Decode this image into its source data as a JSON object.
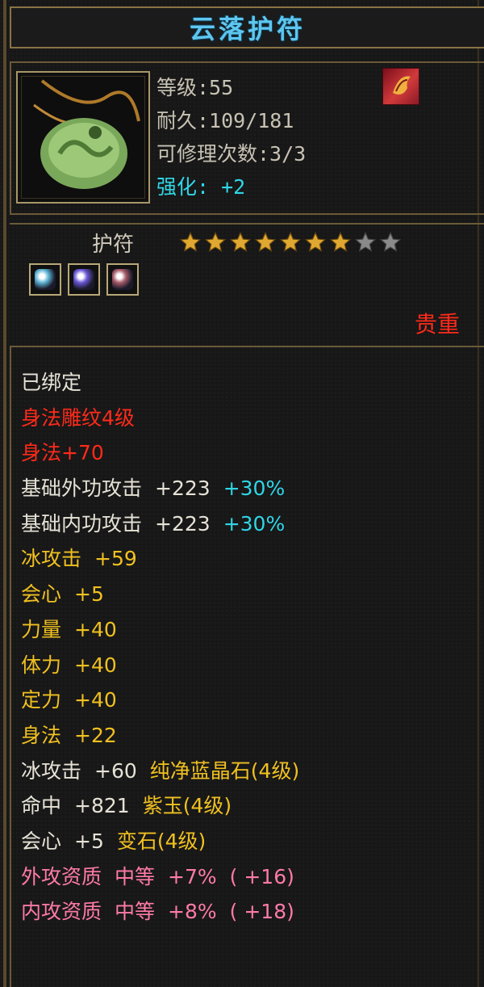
{
  "title": "云落护符",
  "info": {
    "level": "等级:55",
    "durability": "耐久:109/181",
    "repairs": "可修理次数:3/3",
    "enhance": "强化: +2"
  },
  "icons": {
    "item": "jade-pendant-icon",
    "bag": "bind-bag-icon"
  },
  "type": {
    "label": "护符",
    "stars_filled": 7,
    "stars_total": 9,
    "gems": [
      {
        "name": "ice-gem-icon",
        "color": "#5fb6d6"
      },
      {
        "name": "purple-gem-icon",
        "color": "#6a58d8"
      },
      {
        "name": "red-gem-icon",
        "color": "#a85a68"
      }
    ]
  },
  "rarity": "贵重",
  "colors": {
    "star_gold": "#e0a830",
    "star_grey": "#8a8a8a"
  },
  "attributes": [
    {
      "parts": [
        {
          "t": "已绑定",
          "c": "w"
        }
      ]
    },
    {
      "parts": [
        {
          "t": "身法雕纹4级",
          "c": "r"
        }
      ]
    },
    {
      "parts": [
        {
          "t": "身法+70",
          "c": "r"
        }
      ]
    },
    {
      "parts": [
        {
          "t": "基础外功攻击",
          "c": "w"
        },
        {
          "t": "+223",
          "c": "w"
        },
        {
          "t": "+30%",
          "c": "c"
        }
      ]
    },
    {
      "parts": [
        {
          "t": "基础内功攻击",
          "c": "w"
        },
        {
          "t": "+223",
          "c": "w"
        },
        {
          "t": "+30%",
          "c": "c"
        }
      ]
    },
    {
      "parts": [
        {
          "t": "冰攻击",
          "c": "y"
        },
        {
          "t": "+59",
          "c": "y"
        }
      ]
    },
    {
      "parts": [
        {
          "t": "会心",
          "c": "y"
        },
        {
          "t": "+5",
          "c": "y"
        }
      ]
    },
    {
      "parts": [
        {
          "t": "力量",
          "c": "y"
        },
        {
          "t": "+40",
          "c": "y"
        }
      ]
    },
    {
      "parts": [
        {
          "t": "体力",
          "c": "y"
        },
        {
          "t": "+40",
          "c": "y"
        }
      ]
    },
    {
      "parts": [
        {
          "t": "定力",
          "c": "y"
        },
        {
          "t": "+40",
          "c": "y"
        }
      ]
    },
    {
      "parts": [
        {
          "t": "身法",
          "c": "y"
        },
        {
          "t": "+22",
          "c": "y"
        }
      ]
    },
    {
      "parts": [
        {
          "t": "冰攻击",
          "c": "w"
        },
        {
          "t": "+60",
          "c": "w"
        },
        {
          "t": "纯净蓝晶石(4级)",
          "c": "y"
        }
      ]
    },
    {
      "parts": [
        {
          "t": "命中",
          "c": "w"
        },
        {
          "t": "+821",
          "c": "w"
        },
        {
          "t": "紫玉(4级)",
          "c": "y"
        }
      ]
    },
    {
      "parts": [
        {
          "t": "会心",
          "c": "w"
        },
        {
          "t": "+5",
          "c": "w"
        },
        {
          "t": "变石(4级)",
          "c": "y"
        }
      ]
    },
    {
      "parts": [
        {
          "t": "外攻资质",
          "c": "p"
        },
        {
          "t": "中等",
          "c": "p"
        },
        {
          "t": "+7%",
          "c": "p"
        },
        {
          "t": "( +16)",
          "c": "p"
        }
      ]
    },
    {
      "parts": [
        {
          "t": "内攻资质",
          "c": "p"
        },
        {
          "t": "中等",
          "c": "p"
        },
        {
          "t": "+8%",
          "c": "p"
        },
        {
          "t": "( +18)",
          "c": "p"
        }
      ]
    }
  ]
}
